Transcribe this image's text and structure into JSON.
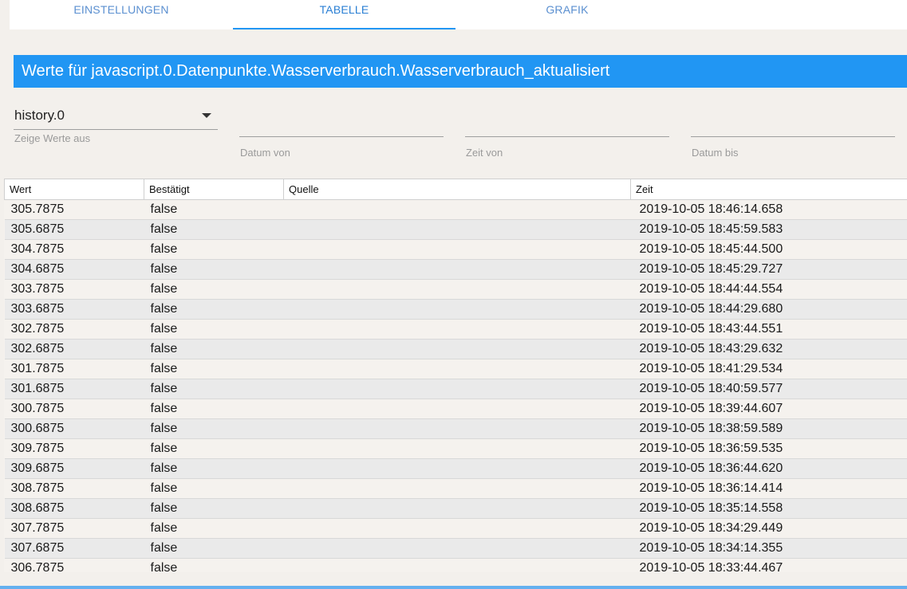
{
  "tabs": [
    {
      "label": "EINSTELLUNGEN"
    },
    {
      "label": "TABELLE"
    },
    {
      "label": "GRAFIK"
    }
  ],
  "title": "Werte für javascript.0.Datenpunkte.Wasserverbrauch.Wasserverbrauch_aktualisiert",
  "filters": {
    "instance": {
      "value": "history.0",
      "label": "Zeige Werte aus"
    },
    "date_from": {
      "label": "Datum von",
      "value": ""
    },
    "time_from": {
      "label": "Zeit von",
      "value": ""
    },
    "date_to": {
      "label": "Datum bis",
      "value": ""
    }
  },
  "table": {
    "columns": [
      "Wert",
      "Bestätigt",
      "Quelle",
      "Zeit"
    ],
    "rows": [
      {
        "wert": "305.7875",
        "ack": "false",
        "quelle": "",
        "zeit": "2019-10-05 18:46:14.658"
      },
      {
        "wert": "305.6875",
        "ack": "false",
        "quelle": "",
        "zeit": "2019-10-05 18:45:59.583"
      },
      {
        "wert": "304.7875",
        "ack": "false",
        "quelle": "",
        "zeit": "2019-10-05 18:45:44.500"
      },
      {
        "wert": "304.6875",
        "ack": "false",
        "quelle": "",
        "zeit": "2019-10-05 18:45:29.727"
      },
      {
        "wert": "303.7875",
        "ack": "false",
        "quelle": "",
        "zeit": "2019-10-05 18:44:44.554"
      },
      {
        "wert": "303.6875",
        "ack": "false",
        "quelle": "",
        "zeit": "2019-10-05 18:44:29.680"
      },
      {
        "wert": "302.7875",
        "ack": "false",
        "quelle": "",
        "zeit": "2019-10-05 18:43:44.551"
      },
      {
        "wert": "302.6875",
        "ack": "false",
        "quelle": "",
        "zeit": "2019-10-05 18:43:29.632"
      },
      {
        "wert": "301.7875",
        "ack": "false",
        "quelle": "",
        "zeit": "2019-10-05 18:41:29.534"
      },
      {
        "wert": "301.6875",
        "ack": "false",
        "quelle": "",
        "zeit": "2019-10-05 18:40:59.577"
      },
      {
        "wert": "300.7875",
        "ack": "false",
        "quelle": "",
        "zeit": "2019-10-05 18:39:44.607"
      },
      {
        "wert": "300.6875",
        "ack": "false",
        "quelle": "",
        "zeit": "2019-10-05 18:38:59.589"
      },
      {
        "wert": "309.7875",
        "ack": "false",
        "quelle": "",
        "zeit": "2019-10-05 18:36:59.535"
      },
      {
        "wert": "309.6875",
        "ack": "false",
        "quelle": "",
        "zeit": "2019-10-05 18:36:44.620"
      },
      {
        "wert": "308.7875",
        "ack": "false",
        "quelle": "",
        "zeit": "2019-10-05 18:36:14.414"
      },
      {
        "wert": "308.6875",
        "ack": "false",
        "quelle": "",
        "zeit": "2019-10-05 18:35:14.558"
      },
      {
        "wert": "307.7875",
        "ack": "false",
        "quelle": "",
        "zeit": "2019-10-05 18:34:29.449"
      },
      {
        "wert": "307.6875",
        "ack": "false",
        "quelle": "",
        "zeit": "2019-10-05 18:34:14.355"
      },
      {
        "wert": "306.7875",
        "ack": "false",
        "quelle": "",
        "zeit": "2019-10-05 18:33:44.467"
      }
    ]
  },
  "colors": {
    "accent": "#2196f3",
    "tab_text": "#5a8fd0",
    "background": "#f3f0ec"
  }
}
